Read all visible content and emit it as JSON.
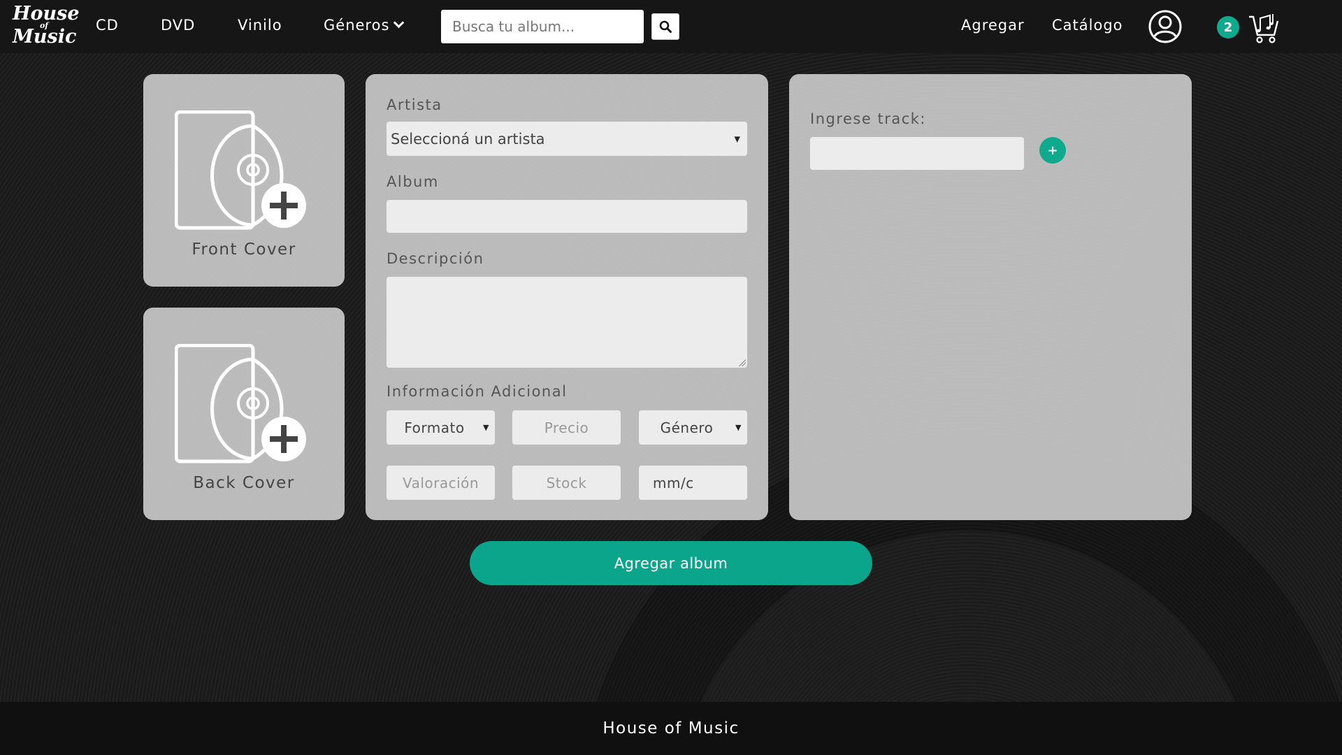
{
  "brand": {
    "logo_line1": "House",
    "logo_line2": "of",
    "logo_line3": "Music"
  },
  "nav": {
    "cd": "CD",
    "dvd": "DVD",
    "vinilo": "Vinilo",
    "generos": "Géneros",
    "agregar": "Agregar",
    "catalogo": "Catálogo"
  },
  "search": {
    "placeholder": "Busca tu album..."
  },
  "cart": {
    "count": "2"
  },
  "covers": {
    "front": "Front Cover",
    "back": "Back Cover"
  },
  "form": {
    "artista_label": "Artista",
    "artista_select": "Seleccioná un artista",
    "album_label": "Album",
    "descripcion_label": "Descripción",
    "info_label": "Información Adicional",
    "formato": "Formato",
    "precio": "Precio",
    "genero": "Género",
    "valoracion": "Valoración",
    "stock": "Stock",
    "fecha": "mm/c"
  },
  "tracks": {
    "label": "Ingrese track:",
    "add_button": "+"
  },
  "submit": {
    "label": "Agregar album"
  },
  "footer": {
    "text": "House of Music"
  },
  "colors": {
    "accent": "#0fa98e",
    "panel": "#c8c8c8",
    "navbar": "#161616"
  }
}
